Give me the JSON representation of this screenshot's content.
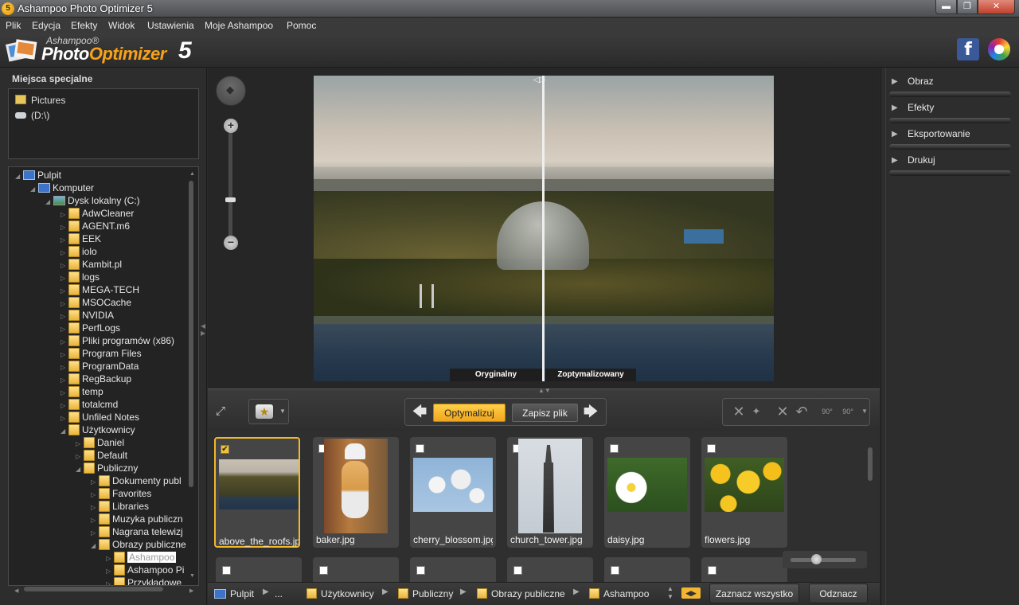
{
  "window": {
    "title": "Ashampoo Photo Optimizer 5",
    "app_icon": "5",
    "minimize": "▬",
    "maximize": "❐",
    "close": "✕"
  },
  "menu": [
    "Plik",
    "Edycja",
    "Efekty",
    "Widok",
    "Ustawienia",
    "Moje Ashampoo",
    "Pomoc"
  ],
  "logo": {
    "brand": "Ashampoo®",
    "photo": "Photo",
    "optimizer": "Optimizer",
    "version": "5"
  },
  "social": {
    "facebook": "f"
  },
  "left_panel": {
    "special_title": "Miejsca specjalne",
    "special_items": [
      "Pictures",
      "(D:\\)"
    ],
    "tree": [
      {
        "label": "Pulpit",
        "icon": "computer-icon",
        "level": 0
      },
      {
        "label": "Komputer",
        "icon": "computer-icon",
        "level": 1
      },
      {
        "label": "Dysk lokalny (C:)",
        "icon": "drive-icon",
        "level": 2
      },
      {
        "label": "AdwCleaner",
        "icon": "folder-icon",
        "level": 3
      },
      {
        "label": "AGENT.m6",
        "icon": "folder-icon",
        "level": 3
      },
      {
        "label": "EEK",
        "icon": "folder-icon",
        "level": 3
      },
      {
        "label": "iolo",
        "icon": "folder-icon",
        "level": 3
      },
      {
        "label": "Kambit.pl",
        "icon": "folder-icon",
        "level": 3
      },
      {
        "label": "logs",
        "icon": "folder-icon",
        "level": 3
      },
      {
        "label": "MEGA-TECH",
        "icon": "folder-icon",
        "level": 3
      },
      {
        "label": "MSOCache",
        "icon": "folder-icon",
        "level": 3
      },
      {
        "label": "NVIDIA",
        "icon": "folder-icon",
        "level": 3
      },
      {
        "label": "PerfLogs",
        "icon": "folder-icon",
        "level": 3
      },
      {
        "label": "Pliki programów (x86)",
        "icon": "folder-icon",
        "level": 3
      },
      {
        "label": "Program Files",
        "icon": "folder-icon",
        "level": 3
      },
      {
        "label": "ProgramData",
        "icon": "folder-icon",
        "level": 3
      },
      {
        "label": "RegBackup",
        "icon": "folder-icon",
        "level": 3
      },
      {
        "label": "temp",
        "icon": "folder-icon",
        "level": 3
      },
      {
        "label": "totalcmd",
        "icon": "folder-icon",
        "level": 3
      },
      {
        "label": "Unfiled Notes",
        "icon": "folder-icon",
        "level": 3
      },
      {
        "label": "Użytkownicy",
        "icon": "folder-icon",
        "level": 3
      },
      {
        "label": "Daniel",
        "icon": "folder-icon",
        "level": 4
      },
      {
        "label": "Default",
        "icon": "folder-icon",
        "level": 4
      },
      {
        "label": "Publiczny",
        "icon": "folder-icon",
        "level": 4
      },
      {
        "label": "Dokumenty publ",
        "icon": "folder-icon",
        "level": 5
      },
      {
        "label": "Favorites",
        "icon": "folder-icon",
        "level": 5
      },
      {
        "label": "Libraries",
        "icon": "folder-icon",
        "level": 5
      },
      {
        "label": "Muzyka publiczn",
        "icon": "folder-icon",
        "level": 5
      },
      {
        "label": "Nagrana telewizj",
        "icon": "folder-icon",
        "level": 5
      },
      {
        "label": "Obrazy publiczne",
        "icon": "folder-icon",
        "level": 5
      },
      {
        "label": "Ashampoo",
        "icon": "folder-icon",
        "level": 6,
        "selected": true
      },
      {
        "label": "Ashampoo Pi",
        "icon": "folder-icon",
        "level": 6
      },
      {
        "label": "Przykładowe",
        "icon": "folder-icon",
        "level": 6
      }
    ]
  },
  "preview": {
    "label_original": "Oryginalny",
    "label_optimized": "Zoptymalizowany",
    "zoom_in": "+",
    "zoom_out": "−"
  },
  "toolbar": {
    "optimize": "Optymalizuj",
    "save": "Zapisz plik",
    "prev": "🡄",
    "next": "🡆",
    "expand": "⤢",
    "wand": "★",
    "dropdown": "▼",
    "rotate_left_90": "90°",
    "rotate_right_90": "90°"
  },
  "thumbnails": [
    {
      "name": "above_the_roofs.jpg",
      "checked": true
    },
    {
      "name": "baker.jpg",
      "checked": false
    },
    {
      "name": "cherry_blossom.jpg",
      "checked": false
    },
    {
      "name": "church_tower.jpg",
      "checked": false
    },
    {
      "name": "daisy.jpg",
      "checked": false
    },
    {
      "name": "flowers.jpg",
      "checked": false
    }
  ],
  "checkmark": "✔",
  "breadcrumb": [
    "Pulpit",
    "...",
    "Użytkownicy",
    "Publiczny",
    "Obrazy publiczne",
    "Ashampoo"
  ],
  "bottom": {
    "select_all": "Zaznacz wszystko",
    "deselect": "Odznacz"
  },
  "right_panel": {
    "sections": [
      "Obraz",
      "Efekty",
      "Eksportowanie",
      "Drukuj"
    ]
  }
}
